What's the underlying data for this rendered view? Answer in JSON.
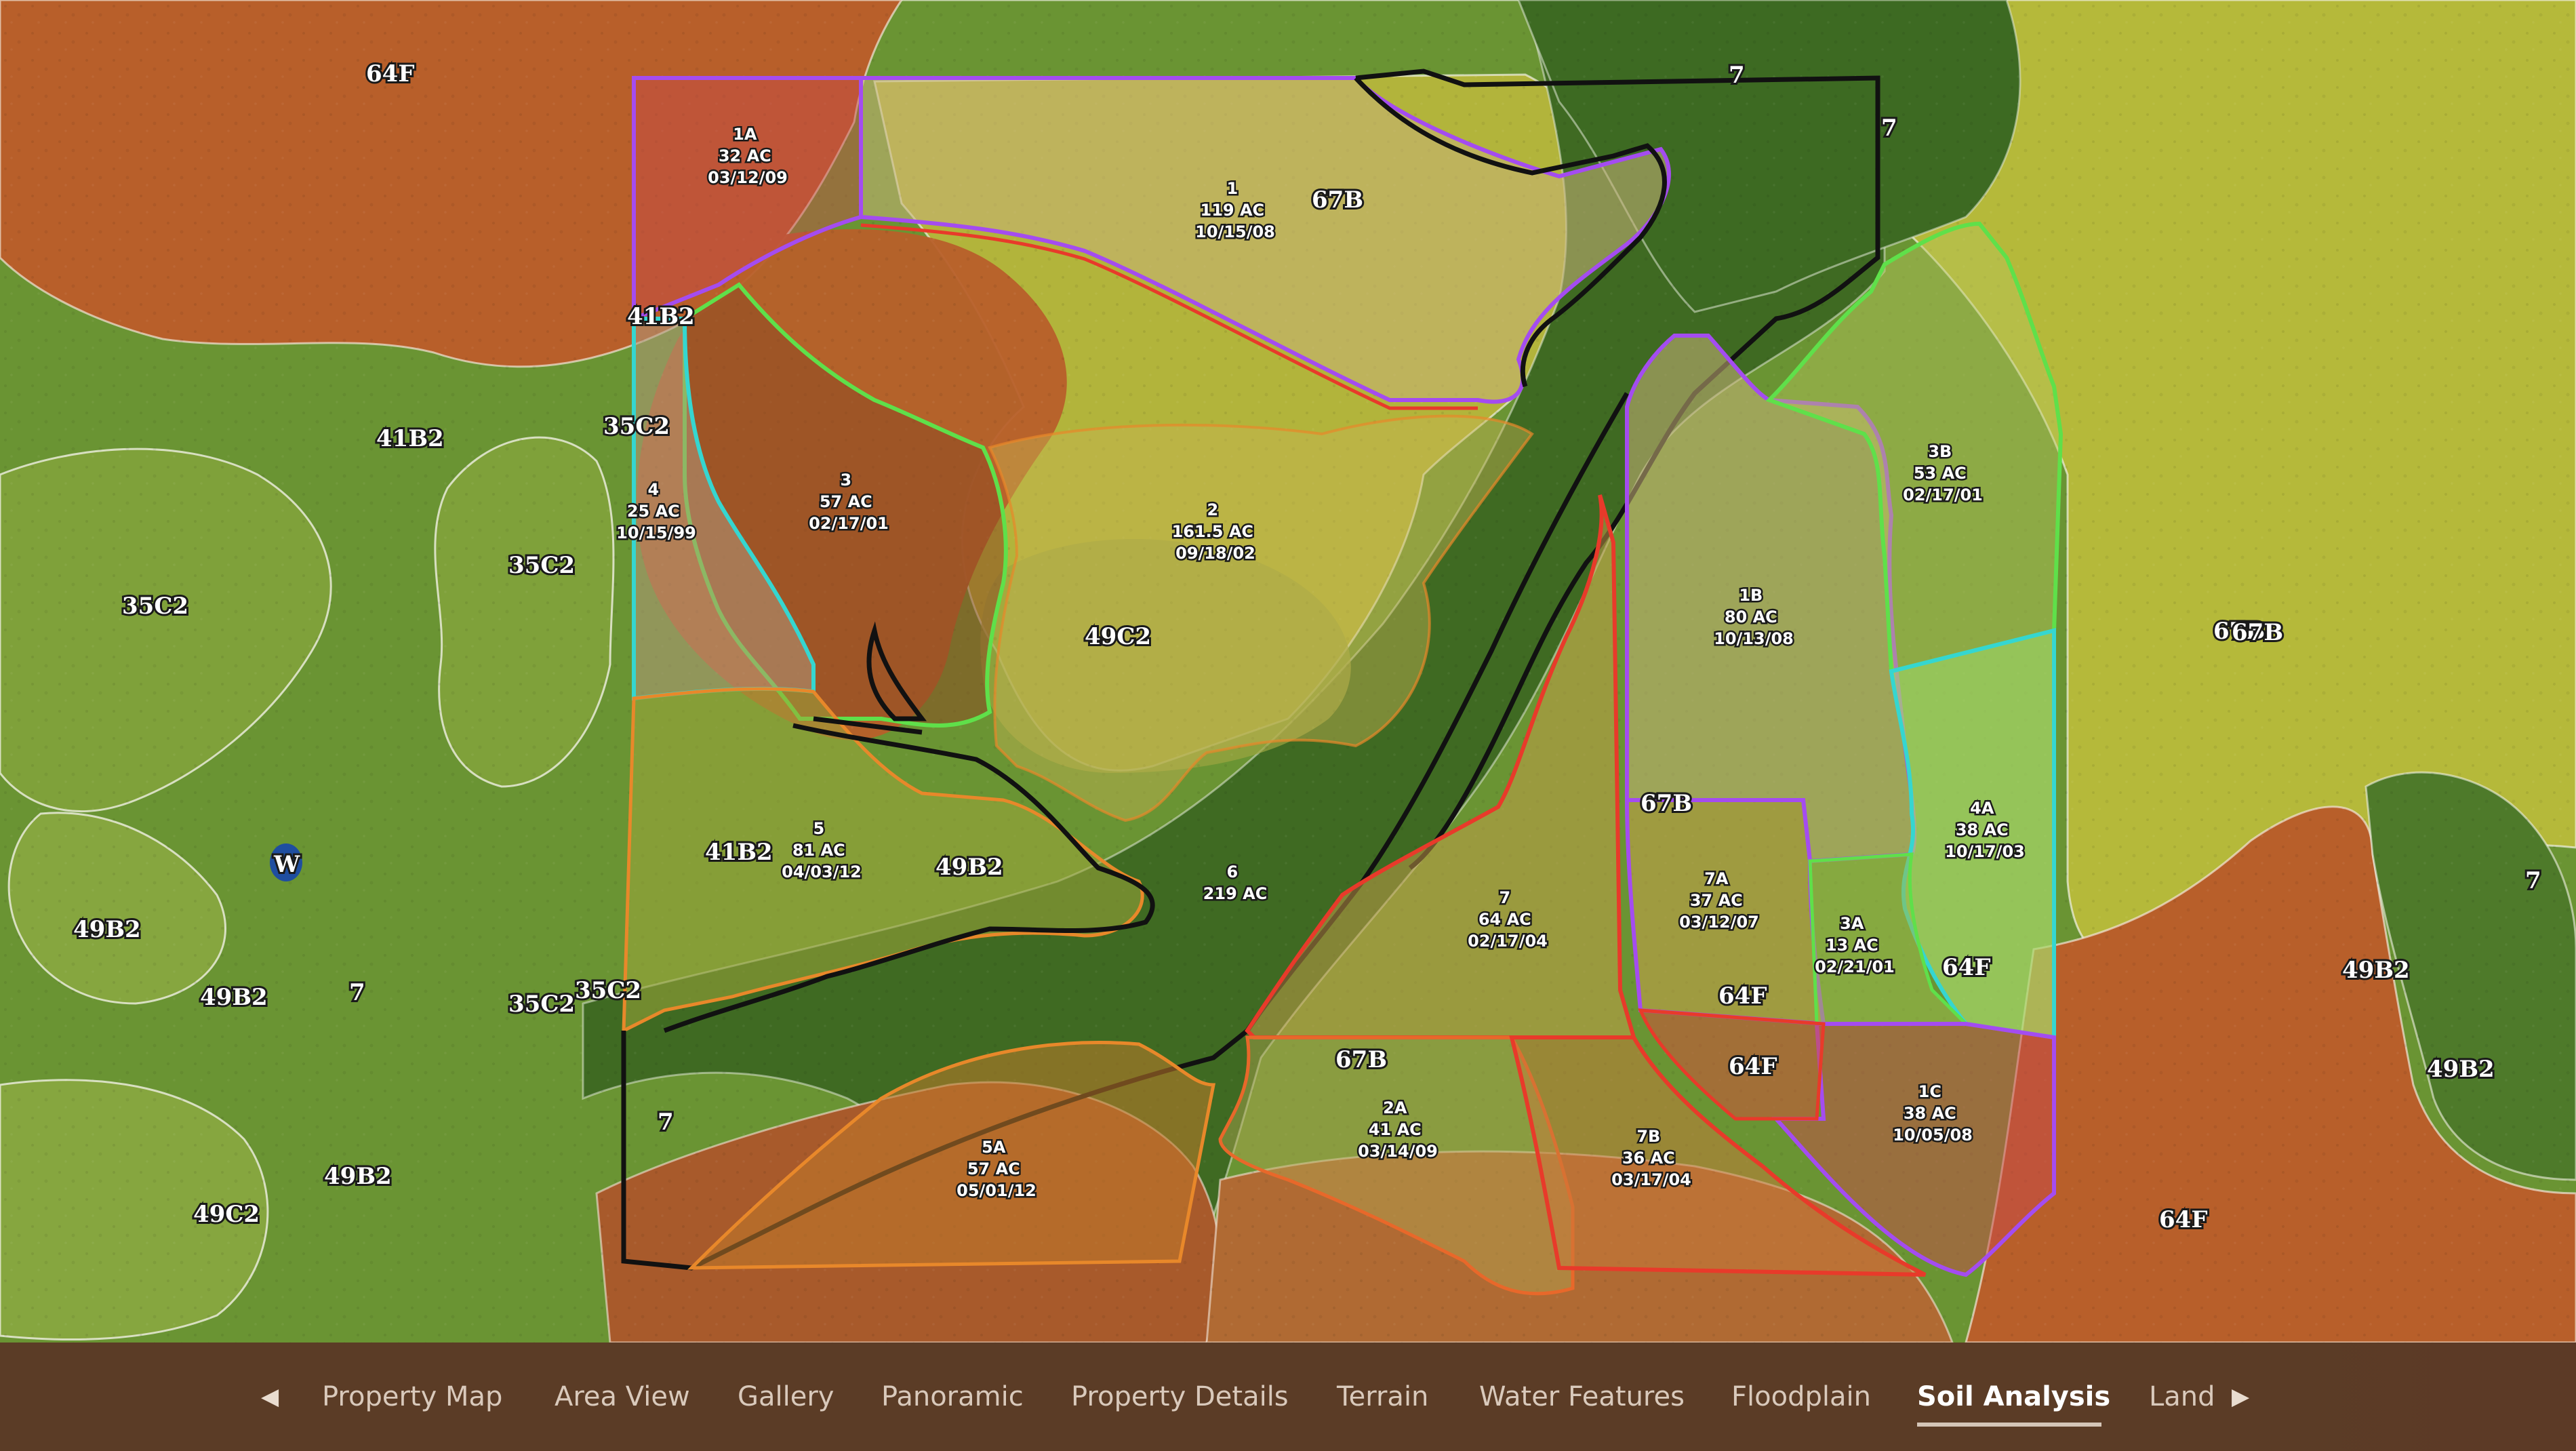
{
  "soil_labels": [
    {
      "id": "s1",
      "text": "64F"
    },
    {
      "id": "s2",
      "text": "67B"
    },
    {
      "id": "s3",
      "text": "41B2"
    },
    {
      "id": "s4",
      "text": "35C2"
    },
    {
      "id": "s5",
      "text": "41B2"
    },
    {
      "id": "s6",
      "text": "35C2"
    },
    {
      "id": "s7",
      "text": "35C2"
    },
    {
      "id": "s8",
      "text": "49C2"
    },
    {
      "id": "s9",
      "text": "41B2"
    },
    {
      "id": "s10",
      "text": "49B2"
    },
    {
      "id": "s11",
      "text": "49B2"
    },
    {
      "id": "s12",
      "text": "49B2"
    },
    {
      "id": "s13",
      "text": "7"
    },
    {
      "id": "s14",
      "text": "35C2"
    },
    {
      "id": "s15",
      "text": "35C2"
    },
    {
      "id": "s16",
      "text": "7"
    },
    {
      "id": "s17",
      "text": "49B2"
    },
    {
      "id": "s18",
      "text": "49C2"
    },
    {
      "id": "s19",
      "text": "67B"
    },
    {
      "id": "s20",
      "text": "7"
    },
    {
      "id": "s21",
      "text": "7"
    },
    {
      "id": "s22",
      "text": "67B"
    },
    {
      "id": "s23",
      "text": "64F"
    },
    {
      "id": "s24",
      "text": "64F"
    },
    {
      "id": "s25",
      "text": "64F"
    },
    {
      "id": "s26",
      "text": "67B"
    },
    {
      "id": "s27",
      "text": "49B2"
    },
    {
      "id": "s28",
      "text": "49B2"
    },
    {
      "id": "s29",
      "text": "7"
    },
    {
      "id": "s30",
      "text": "64F"
    },
    {
      "id": "s31",
      "text": "67B"
    },
    {
      "id": "s32",
      "text": "W"
    }
  ],
  "stands": [
    {
      "id": "1A",
      "lines": [
        "1A",
        "32 AC",
        "03/12/09"
      ]
    },
    {
      "id": "1",
      "lines": [
        "1",
        "119 AC",
        "10/15/08"
      ]
    },
    {
      "id": "3",
      "lines": [
        "3",
        "57 AC",
        "02/17/01"
      ]
    },
    {
      "id": "4",
      "lines": [
        "4",
        "25 AC",
        "10/15/99"
      ]
    },
    {
      "id": "2",
      "lines": [
        "2",
        "161.5 AC",
        "09/18/02"
      ]
    },
    {
      "id": "3B",
      "lines": [
        "3B",
        "53 AC",
        "02/17/01"
      ]
    },
    {
      "id": "1B",
      "lines": [
        "1B",
        "80 AC",
        "10/13/08"
      ]
    },
    {
      "id": "5",
      "lines": [
        "5",
        "81 AC",
        "04/03/12"
      ]
    },
    {
      "id": "6",
      "lines": [
        "6",
        "219 AC"
      ]
    },
    {
      "id": "7",
      "lines": [
        "7",
        "64 AC",
        "02/17/04"
      ]
    },
    {
      "id": "7A",
      "lines": [
        "7A",
        "37 AC",
        "03/12/07"
      ]
    },
    {
      "id": "3A",
      "lines": [
        "3A",
        "13 AC",
        "02/21/01"
      ]
    },
    {
      "id": "4A",
      "lines": [
        "4A",
        "38 AC",
        "10/17/03"
      ]
    },
    {
      "id": "1C",
      "lines": [
        "1C",
        "38 AC",
        "10/05/08"
      ]
    },
    {
      "id": "2A",
      "lines": [
        "2A",
        "41 AC",
        "03/14/09"
      ]
    },
    {
      "id": "7B",
      "lines": [
        "7B",
        "36 AC",
        "03/17/04"
      ]
    },
    {
      "id": "5A",
      "lines": [
        "5A",
        "57 AC",
        "05/01/12"
      ]
    }
  ],
  "nav": {
    "items": [
      "Property Map",
      "Area View",
      "Gallery",
      "Panoramic",
      "Property Details",
      "Terrain",
      "Water Features",
      "Floodplain",
      "Soil Analysis",
      "Land"
    ],
    "active_index": 8,
    "prev_icon": "chevron-left-icon",
    "next_icon": "chevron-right-icon"
  },
  "colors": {
    "soil_64F": "#b85f2a",
    "soil_67B": "#b5b93a",
    "soil_7": "#3f6a22",
    "soil_green": "#6a9433",
    "stand_purple": "#a44cf0",
    "stand_red": "#e83a2a",
    "stand_green": "#5fe04a",
    "stand_cyan": "#35d6d0",
    "stand_orange": "#e8882a",
    "stand_black": "#111111"
  }
}
